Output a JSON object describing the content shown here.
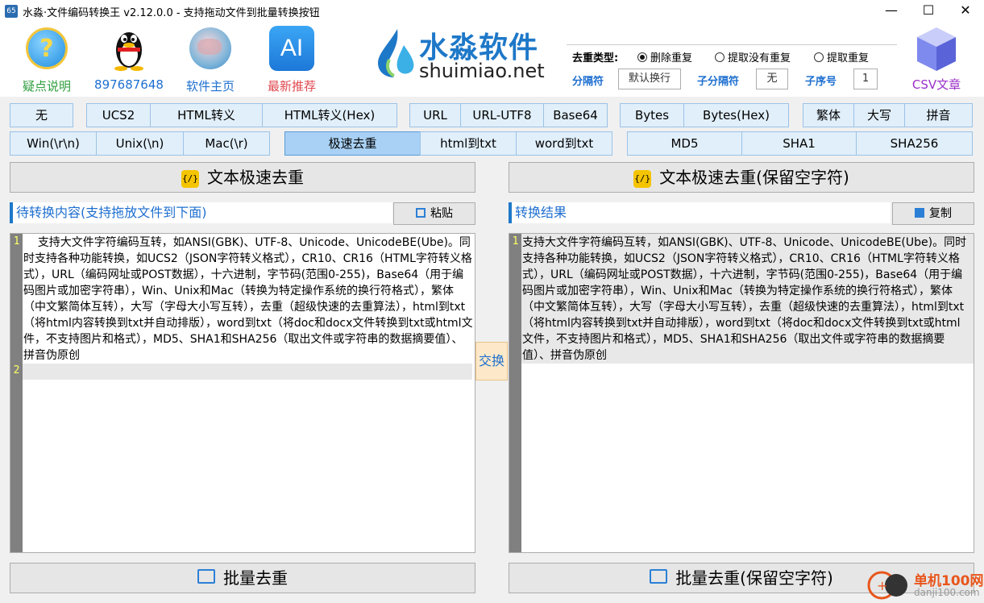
{
  "window": {
    "title": "水淼·文件编码转换王 v2.12.0.0 - 支持拖动文件到批量转换按钮",
    "icon_text": "65",
    "controls": [
      "minimize-icon",
      "maximize-icon",
      "close-icon"
    ]
  },
  "header": {
    "buttons": [
      {
        "label": "疑点说明",
        "icon": "question-icon",
        "color": "#2e9e3e"
      },
      {
        "label": "897687648",
        "icon": "qq-penguin-icon",
        "color": "#1e6fd0"
      },
      {
        "label": "软件主页",
        "icon": "globe-icon",
        "color": "#1e6fd0"
      },
      {
        "label": "最新推荐",
        "icon": "ai-icon",
        "color": "#e0484f"
      }
    ],
    "brand_cn": "水淼软件",
    "brand_en": "shuimiao.net",
    "csv_label": "CSV文章"
  },
  "dedup": {
    "type_label": "去重类型:",
    "options": [
      "删除重复",
      "提取没有重复",
      "提取重复"
    ],
    "selected": "删除重复",
    "separator_label": "分隔符",
    "separator_value": "默认换行",
    "sub_separator_label": "子分隔符",
    "sub_separator_value": "无",
    "index_label": "子序号",
    "index_value": "1"
  },
  "toolbar_row1": {
    "group1": [
      "无"
    ],
    "group2": [
      "UCS2",
      "HTML转义",
      "HTML转义(Hex)"
    ],
    "group3": [
      "URL",
      "URL-UTF8",
      "Base64"
    ],
    "group4": [
      "Bytes",
      "Bytes(Hex)"
    ],
    "group5": [
      "繁体",
      "大写",
      "拼音"
    ]
  },
  "toolbar_row2": {
    "group1": [
      "Win(\\r\\n)",
      "Unix(\\n)",
      "Mac(\\r)"
    ],
    "group2": [
      "极速去重",
      "html到txt",
      "word到txt"
    ],
    "group3": [
      "MD5",
      "SHA1",
      "SHA256"
    ],
    "active": "极速去重"
  },
  "actions": {
    "left": "文本极速去重",
    "right": "文本极速去重(保留空字符)",
    "left_batch": "批量去重",
    "right_batch": "批量去重(保留空字符)",
    "swap": "交换"
  },
  "input_panel": {
    "title": "待转换内容(支持拖放文件到下面)",
    "paste": "粘贴",
    "line_numbers": [
      "1",
      "2"
    ],
    "text": "    支持大文件字符编码互转，如ANSI(GBK)、UTF-8、Unicode、UnicodeBE(Ube)。同时支持各种功能转换，如UCS2（JSON字符转义格式），CR10、CR16（HTML字符转义格式），URL（编码网址或POST数据），十六进制，字节码(范围0-255)，Base64（用于编码图片或加密字符串），Win、Unix和Mac（转换为特定操作系统的换行符格式），繁体（中文繁简体互转），大写（字母大小写互转），去重（超级快速的去重算法），html到txt（将html内容转换到txt并自动排版），word到txt（将doc和docx文件转换到txt或html文件，不支持图片和格式），MD5、SHA1和SHA256（取出文件或字符串的数据摘要值）、拼音伪原创"
  },
  "output_panel": {
    "title": "转换结果",
    "copy": "复制",
    "line_numbers": [
      "1"
    ],
    "text": "支持大文件字符编码互转，如ANSI(GBK)、UTF-8、Unicode、UnicodeBE(Ube)。同时支持各种功能转换，如UCS2（JSON字符转义格式），CR10、CR16（HTML字符转义格式），URL（编码网址或POST数据），十六进制，字节码(范围0-255)，Base64（用于编码图片或加密字符串），Win、Unix和Mac（转换为特定操作系统的换行符格式），繁体（中文繁简体互转），大写（字母大小写互转），去重（超级快速的去重算法），html到txt（将html内容转换到txt并自动排版），word到txt（将doc和docx文件转换到txt或html文件，不支持图片和格式），MD5、SHA1和SHA256（取出文件或字符串的数据摘要值）、拼音伪原创"
  },
  "watermark": {
    "text": "单机100网",
    "sub": "danji100.com"
  },
  "colors": {
    "accent": "#1e78c8",
    "toolbar_bg": "#e1effa",
    "active_bg": "#a9d1f5"
  }
}
